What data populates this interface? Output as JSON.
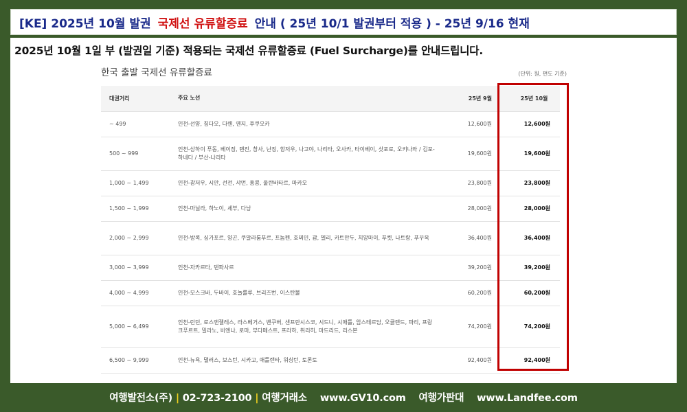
{
  "title": {
    "prefix": "[KE] 2025년 10월  발권",
    "highlight": "국제선  유류할증료",
    "suffix": "안내  ( 25년  10/1 발권부터 적용 )  - 25년  9/16 현재"
  },
  "lead_text": "2025년 10월 1일 부 (발권일 기준) 적용되는 국제선 유류할증료 (Fuel Surcharge)를 안내드립니다.",
  "table": {
    "title": "한국 출발 국제선 유류할증료",
    "unit_note": "(단위: 원, 편도 기준)",
    "headers": [
      "대권거리",
      "주요 노선",
      "25년 9월",
      "25년 10월"
    ],
    "rows": [
      {
        "distance": "~ 499",
        "routes": "인천-선양, 칭다오, 다롄, 옌지, 후쿠오카",
        "sep": "12,600원",
        "oct": "12,600원"
      },
      {
        "distance": "500 ~ 999",
        "routes": "인천-상하이 푸동, 베이징, 톈진, 창사, 난징, 항저우, 나고야, 나리타, 오사카, 타이베이, 삿포로, 오키나와 / 김포-하네다 / 부산-나리타",
        "sep": "19,600원",
        "oct": "19,600원"
      },
      {
        "distance": "1,000 ~ 1,499",
        "routes": "인천-광저우, 시안, 선전, 샤먼, 홍콩, 울란바타르, 마카오",
        "sep": "23,800원",
        "oct": "23,800원"
      },
      {
        "distance": "1,500 ~ 1,999",
        "routes": "인천-마닐라, 하노이, 세부, 다낭",
        "sep": "28,000원",
        "oct": "28,000원"
      },
      {
        "distance": "2,000 ~ 2,999",
        "routes": "인천-방콕, 싱가포르, 양곤, 쿠알라룸푸르, 프놈펜, 호찌민, 괌, 델리, 카트만두, 치앙마이, 푸켓, 나트랑, 푸꾸옥",
        "sep": "36,400원",
        "oct": "36,400원"
      },
      {
        "distance": "3,000 ~ 3,999",
        "routes": "인천-자카르타, 덴파사르",
        "sep": "39,200원",
        "oct": "39,200원"
      },
      {
        "distance": "4,000 ~ 4,999",
        "routes": "인천-모스크바, 두바이, 호놀룰루, 브리즈번, 이스탄불",
        "sep": "60,200원",
        "oct": "60,200원"
      },
      {
        "distance": "5,000 ~ 6,499",
        "routes": "인천-런던, 로스앤젤레스, 라스베거스, 밴쿠버, 샌프란시스코, 시드니, 시애틀, 암스테르담, 오클랜드, 파리, 프랑크푸르트, 밀라노, 비엔나, 로마, 부다페스트, 프라하, 취리히, 마드리드, 리스본",
        "sep": "74,200원",
        "oct": "74,200원"
      },
      {
        "distance": "6,500 ~ 9,999",
        "routes": "인천-뉴욕, 댈러스, 보스턴, 시카고, 애틀랜타, 워싱턴, 토론토",
        "sep": "92,400원",
        "oct": "92,400원"
      }
    ]
  },
  "footer": {
    "company": "여행발전소(주)",
    "sep": "|",
    "phone": "02-723-2100",
    "label1": "여행거래소",
    "site1": "www.GV10.com",
    "label2": "여행가판대",
    "site2": "www.Landfee.com"
  },
  "colors": {
    "background": "#3a5a2a",
    "title_text": "#1a2a8a",
    "title_highlight": "#d01010",
    "box_highlight": "#c00000",
    "footer_separator": "#f0d020"
  }
}
